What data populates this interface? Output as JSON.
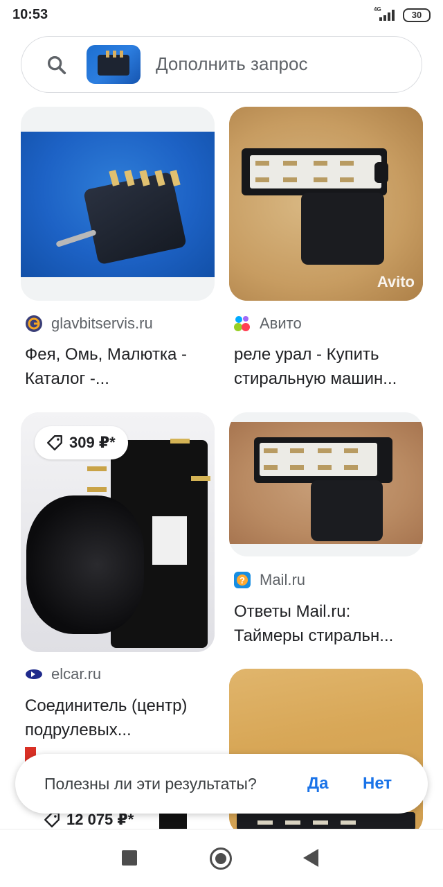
{
  "status_bar": {
    "time": "10:53",
    "network": "4G",
    "battery": "30"
  },
  "search": {
    "placeholder": "Дополнить запрос"
  },
  "results": [
    {
      "source": "glavbitservis.ru",
      "favicon": "g-circle-icon",
      "title_line1": "Фея, Омь, Малютка -",
      "title_line2": "Каталог -..."
    },
    {
      "source": "Авито",
      "favicon": "avito-dots-icon",
      "title_line1": "реле урал - Купить",
      "title_line2": "стиральную машин...",
      "watermark": "Avito"
    },
    {
      "source": "elcar.ru",
      "favicon": "elcar-eye-icon",
      "title_line1": "Соединитель (центр)",
      "title_line2": "подрулевых...",
      "price": "309 ₽*"
    },
    {
      "source": "Mail.ru",
      "favicon": "mailru-question-icon",
      "title_line1": "Ответы Mail.ru:",
      "title_line2": "Таймеры стиральн..."
    }
  ],
  "partial_price": "12 075 ₽*",
  "feedback": {
    "question": "Полезны ли эти результаты?",
    "yes": "Да",
    "no": "Нет"
  },
  "colors": {
    "accent": "#1a73e8",
    "text": "#202124",
    "muted": "#5f6368"
  }
}
